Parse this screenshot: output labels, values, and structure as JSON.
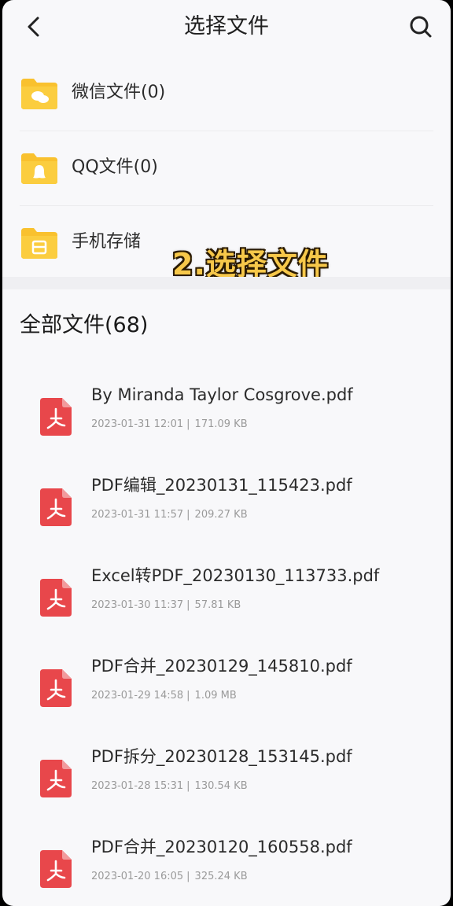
{
  "header": {
    "title": "选择文件",
    "back_icon": "chevron-left-icon",
    "search_icon": "search-icon"
  },
  "folders": [
    {
      "label": "微信文件(0)",
      "icon": "wechat-folder-icon"
    },
    {
      "label": "QQ文件(0)",
      "icon": "qq-folder-icon"
    },
    {
      "label": "手机存储",
      "icon": "storage-folder-icon"
    }
  ],
  "overlay_caption": "2.选择文件",
  "all_files": {
    "heading": "全部文件(68)",
    "separator": "|",
    "items": [
      {
        "name": "By Miranda Taylor Cosgrove.pdf",
        "date": "2023-01-31 12:01",
        "size": "171.09 KB"
      },
      {
        "name": "PDF编辑_20230131_115423.pdf",
        "date": "2023-01-31 11:57",
        "size": "209.27 KB"
      },
      {
        "name": "Excel转PDF_20230130_113733.pdf",
        "date": "2023-01-30 11:37",
        "size": "57.81 KB"
      },
      {
        "name": "PDF合并_20230129_145810.pdf",
        "date": "2023-01-29 14:58",
        "size": "1.09 MB"
      },
      {
        "name": "PDF拆分_20230128_153145.pdf",
        "date": "2023-01-28 15:31",
        "size": "130.54 KB"
      },
      {
        "name": "PDF合并_20230120_160558.pdf",
        "date": "2023-01-20 16:05",
        "size": "325.24 KB"
      }
    ]
  },
  "colors": {
    "folder_yellow": "#f9c12e",
    "pdf_red": "#e8474b",
    "caption_yellow": "#f7c84a"
  }
}
